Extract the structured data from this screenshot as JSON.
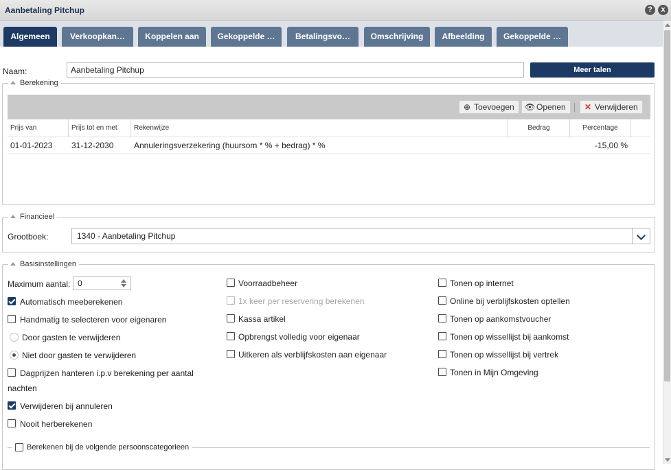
{
  "window": {
    "title": "Aanbetaling Pitchup",
    "help_icon": "?",
    "close_icon": "x"
  },
  "tabs": [
    {
      "label": "Algemeen",
      "active": true
    },
    {
      "label": "Verkoopkan…"
    },
    {
      "label": "Koppelen aan"
    },
    {
      "label": "Gekoppelde …"
    },
    {
      "label": "Betalingsvo…"
    },
    {
      "label": "Omschrijving"
    },
    {
      "label": "Afbeelding"
    },
    {
      "label": "Gekoppelde …"
    }
  ],
  "form": {
    "name_label": "Naam:",
    "name_value": "Aanbetaling Pitchup",
    "more_languages": "Meer talen"
  },
  "berekening": {
    "legend": "Berekening",
    "toolbar": {
      "add": "Toevoegen",
      "open": "Openen",
      "delete": "Verwijderen"
    },
    "columns": [
      "Prijs van",
      "Prijs tot en met",
      "Rekenwijze",
      "Bedrag",
      "Percentage"
    ],
    "rows": [
      {
        "from": "01-01-2023",
        "to": "31-12-2030",
        "method": "Annuleringsverzekering (huursom * % + bedrag) * %",
        "amount": "",
        "percentage": "-15,00 %"
      }
    ]
  },
  "financieel": {
    "legend": "Financieel",
    "ledger_label": "Grootboek:",
    "ledger_value": "1340 - Aanbetaling Pitchup"
  },
  "basis": {
    "legend": "Basisinstellingen",
    "max_label": "Maximum aantal:",
    "max_value": "0",
    "col1": {
      "auto_calc": "Automatisch meeberekenen",
      "manual_select": "Handmatig te selecteren voor eigenaren",
      "radio_remove": "Door gasten te verwijderen",
      "radio_not_remove": "Niet door gasten te verwijderen",
      "day_prices_1": "Dagprijzen hanteren i.p.v berekening per aantal",
      "day_prices_2": "nachten",
      "remove_on_cancel": "Verwijderen bij annuleren",
      "never_recalc": "Nooit herberekenen"
    },
    "col2": {
      "stock": "Voorraadbeheer",
      "once_per_booking": "1x keer per reservering berekenen",
      "pos_item": "Kassa artikel",
      "full_revenue": "Opbrengst volledig voor eigenaar",
      "payout": "Uitkeren als verblijfskosten aan eigenaar"
    },
    "col3": {
      "show_internet": "Tonen op internet",
      "online_add": "Online bij verblijfskosten optellen",
      "show_voucher": "Tonen op aankomstvoucher",
      "show_arrival_list": "Tonen op wissellijst bij aankomst",
      "show_departure_list": "Tonen op wissellijst bij vertrek",
      "show_my_env": "Tonen in Mijn Omgeving"
    },
    "person_categories": "Berekenen bij de volgende persoonscategorieen"
  }
}
